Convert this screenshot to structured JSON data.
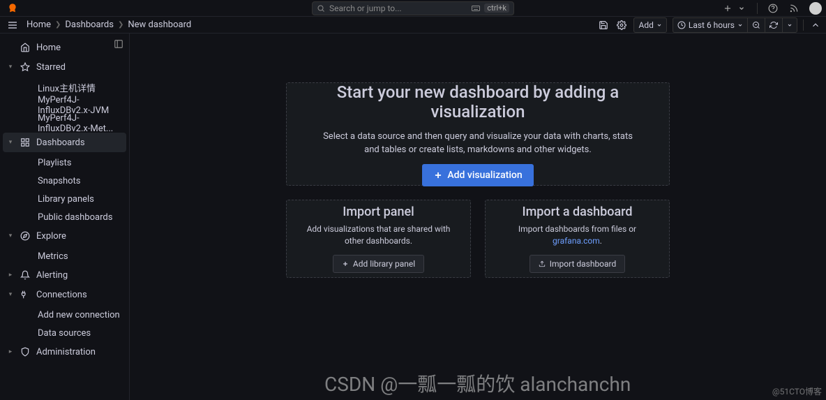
{
  "topbar": {
    "search_placeholder": "Search or jump to...",
    "kbd": "ctrl+k"
  },
  "breadcrumb": {
    "home": "Home",
    "dashboards": "Dashboards",
    "current": "New dashboard"
  },
  "header": {
    "add": "Add",
    "time_range": "Last 6 hours"
  },
  "sidebar": {
    "home": "Home",
    "starred": "Starred",
    "starred_items": [
      "Linux主机详情",
      "MyPerf4J-InfluxDBv2.x-JVM",
      "MyPerf4J-InfluxDBv2.x-Met..."
    ],
    "dashboards": "Dashboards",
    "dash_items": [
      "Playlists",
      "Snapshots",
      "Library panels",
      "Public dashboards"
    ],
    "explore": "Explore",
    "explore_items": [
      "Metrics"
    ],
    "alerting": "Alerting",
    "connections": "Connections",
    "conn_items": [
      "Add new connection",
      "Data sources"
    ],
    "administration": "Administration"
  },
  "main": {
    "big_title": "Start your new dashboard by adding a visualization",
    "big_desc": "Select a data source and then query and visualize your data with charts, stats and tables or create lists, markdowns and other widgets.",
    "big_btn": "Add visualization",
    "panel_title": "Import panel",
    "panel_desc": "Add visualizations that are shared with other dashboards.",
    "panel_btn": "Add library panel",
    "dash_title": "Import a dashboard",
    "dash_desc_a": "Import dashboards from files or ",
    "dash_desc_link": "grafana.com",
    "dash_desc_b": ".",
    "dash_btn": "Import dashboard"
  },
  "watermark": {
    "w1": "CSDN @一瓢一瓢的饮 alanchanchn",
    "w2": "@51CTO博客"
  }
}
